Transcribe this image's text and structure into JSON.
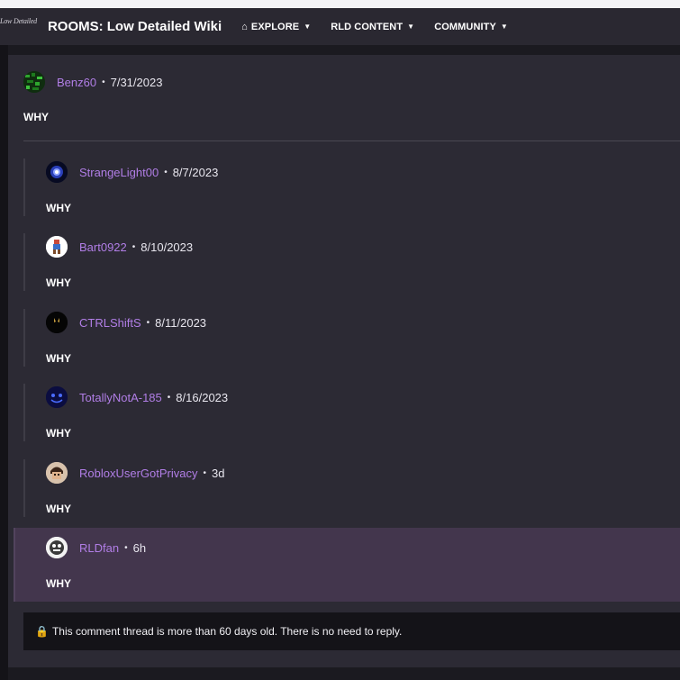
{
  "header": {
    "logo_text": "Low Detailed",
    "wiki_title": "ROOMS: Low Detailed Wiki",
    "nav": [
      {
        "label": "EXPLORE"
      },
      {
        "label": "RLD CONTENT"
      },
      {
        "label": "COMMUNITY"
      }
    ]
  },
  "thread": {
    "root": {
      "user": "Benz60",
      "date": "7/31/2023",
      "text": "WHY"
    },
    "replies": [
      {
        "user": "StrangeLight00",
        "date": "8/7/2023",
        "text": "WHY"
      },
      {
        "user": "Bart0922",
        "date": "8/10/2023",
        "text": "WHY"
      },
      {
        "user": "CTRLShiftS",
        "date": "8/11/2023",
        "text": "WHY"
      },
      {
        "user": "TotallyNotA-185",
        "date": "8/16/2023",
        "text": "WHY"
      },
      {
        "user": "RobloxUserGotPrivacy",
        "date": "3d",
        "text": "WHY"
      },
      {
        "user": "RLDfan",
        "date": "6h",
        "text": "WHY"
      }
    ],
    "separator": "•",
    "notice": "This comment thread is more than 60 days old. There is no need to reply."
  },
  "colors": {
    "username": "#b17ee6",
    "highlight": "#43364d",
    "lock": "#f2c230"
  }
}
